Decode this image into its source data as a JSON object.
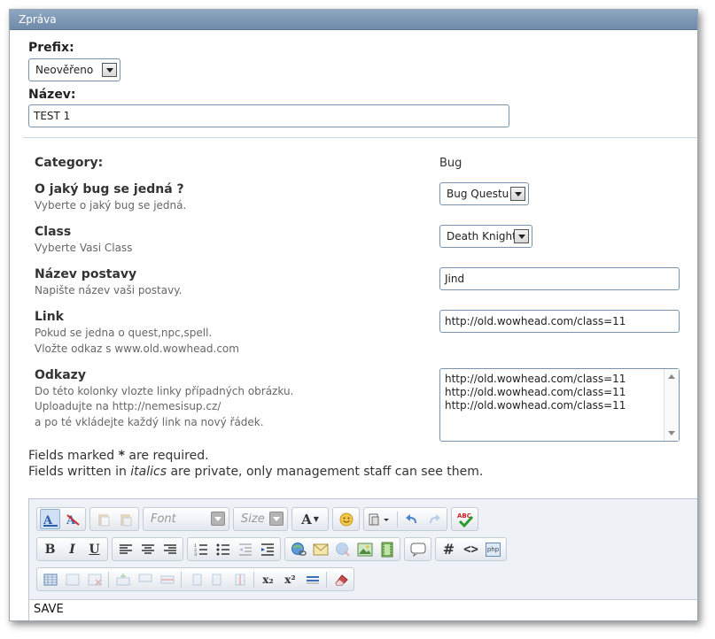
{
  "window": {
    "title": "Zpráva"
  },
  "prefix": {
    "label": "Prefix:",
    "value": "Neověřeno"
  },
  "name": {
    "label": "Název:",
    "value": "TEST 1"
  },
  "fields": {
    "category": {
      "title": "Category:",
      "value": "Bug"
    },
    "bug_type": {
      "title": "O jaký bug se jedná ?",
      "desc": "Vyberte o jaký bug se jedná.",
      "value": "Bug Questu"
    },
    "class": {
      "title": "Class",
      "desc": "Vyberte Vasi Class",
      "value": "Death Knight"
    },
    "character": {
      "title": "Název postavy",
      "desc": "Napište název vaši postavy.",
      "value": "Jind"
    },
    "link": {
      "title": "Link",
      "desc1": "Pokud se jedna o quest,npc,spell.",
      "desc2": "Vložte odkaz s www.old.wowhead.com",
      "value": "http://old.wowhead.com/class=11"
    },
    "links": {
      "title": "Odkazy",
      "desc1": "Do této kolonky vlozte linky případných obrázku.",
      "desc2": "Uploadujte na http://nemesisup.cz/",
      "desc3": "a po té vkládejte každý link na nový řádek.",
      "lines": [
        "http://old.wowhead.com/class=11",
        "http://old.wowhead.com/class=11",
        "http://old.wowhead.com/class=11"
      ]
    }
  },
  "notes": {
    "required_pre": "Fields marked ",
    "required_star": "*",
    "required_post": " are required.",
    "private_pre": "Fields written in ",
    "private_italic": "italics",
    "private_post": " are private, only management staff can see them."
  },
  "editor": {
    "font_placeholder": "Font",
    "size_placeholder": "Size",
    "bold": "B",
    "italic": "I",
    "underline": "U",
    "font_color": "A",
    "hash": "#",
    "code": "<>",
    "php": "php",
    "sub": "x₂",
    "sup": "x²",
    "content": "SAVE"
  },
  "colors": {
    "titlebar": "#7b94b0",
    "border": "#7a93ad",
    "accent": "#3b6fb6"
  }
}
